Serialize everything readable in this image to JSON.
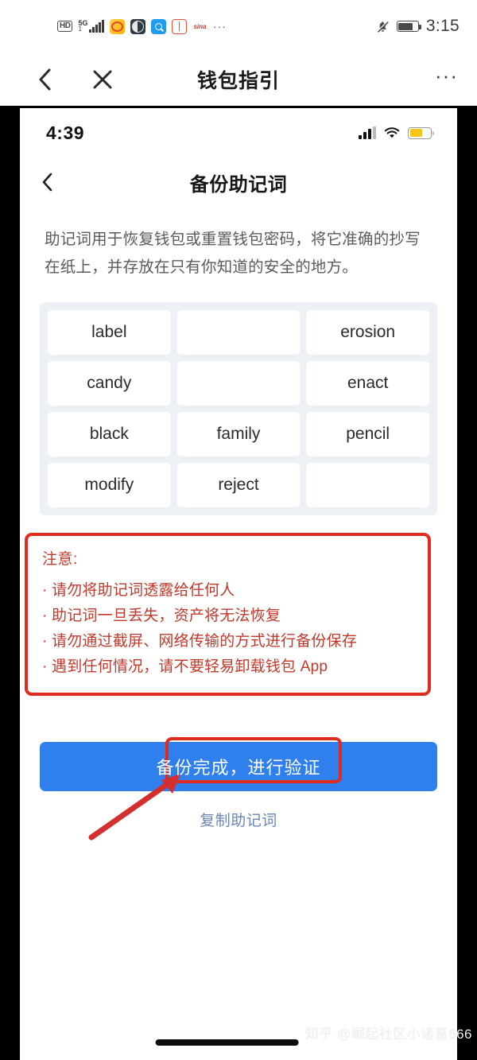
{
  "outer": {
    "statusbar": {
      "hd_badge": "HD",
      "network_label": "5G",
      "network_sub": "1",
      "icons": [
        {
          "name": "weibo-icon"
        },
        {
          "name": "globe-icon"
        },
        {
          "name": "search-app-icon"
        },
        {
          "name": "book-app-icon"
        },
        {
          "name": "sina-icon",
          "label": "sina"
        }
      ],
      "overflow": "···",
      "mute_icon": "bell-muted-icon",
      "battery_icon": "battery-icon",
      "time": "3:15"
    },
    "nav": {
      "back_icon": "chevron-left-icon",
      "close_icon": "close-icon",
      "title": "钱包指引",
      "more": "···"
    }
  },
  "inner": {
    "statusbar": {
      "time": "4:39",
      "cellular_icon": "cellular-signal-icon",
      "wifi_icon": "wifi-icon",
      "battery_icon": "battery-low-icon"
    },
    "nav": {
      "back_icon": "chevron-left-icon",
      "title": "备份助记词"
    },
    "description": "助记词用于恢复钱包或重置钱包密码，将它准确的抄写在纸上，并存放在只有你知道的安全的地方。",
    "mnemonic_words": [
      "label",
      "",
      "erosion",
      "candy",
      "",
      "enact",
      "black",
      "family",
      "pencil",
      "modify",
      "reject",
      ""
    ],
    "warning": {
      "title": "注意:",
      "items": [
        "请勿将助记词透露给任何人",
        "助记词一旦丢失，资产将无法恢复",
        "请勿通过截屏、网络传输的方式进行备份保存",
        "遇到任何情况，请不要轻易卸载钱包 App"
      ]
    },
    "primary_button": "备份完成，进行验证",
    "copy_link": "复制助记词"
  },
  "annotations": {
    "highlight_color": "#e02b20",
    "arrow_color": "#d32f2f"
  },
  "watermark": "知乎 @崛起社区小诸葛666",
  "colors": {
    "primary_blue": "#2f80ed",
    "warning_red": "#c0392b",
    "link_blue": "#6a87b4",
    "grid_bg": "#edf0f4"
  }
}
